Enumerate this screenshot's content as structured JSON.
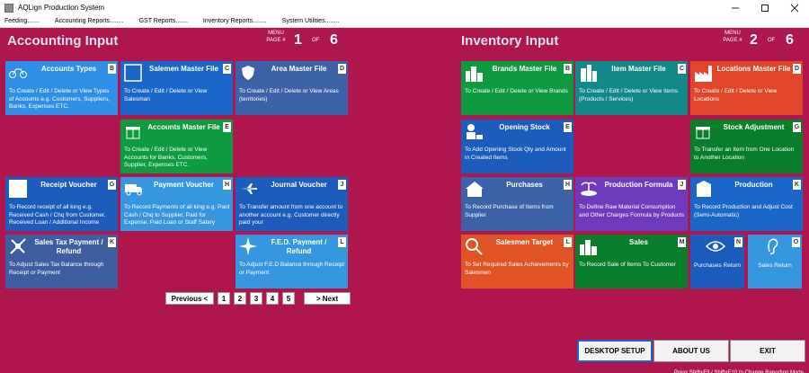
{
  "window": {
    "title": "AQLign Production System"
  },
  "menu": [
    "Feeding.......",
    "Accounting Reports........",
    "GST Reports.......",
    "Inventory Reports........",
    "System Utilities........"
  ],
  "accounting": {
    "title": "Accounting Input",
    "menu_label": "MENU",
    "page_label": "PAGE #",
    "page": "1",
    "of": "OF",
    "total": "6",
    "tiles": [
      {
        "title": "Accounts Types",
        "key": "B",
        "desc": "To Create / Edit / Delete or View Types of Accounts e.g. Customers, Suppliers, Banks, Expenses ETC.",
        "icon": "bicycle-icon"
      },
      {
        "title": "Salemen Master File",
        "key": "C",
        "desc": "To Create / Edit / Delete or View Salesman",
        "icon": "blank-square-icon"
      },
      {
        "title": "Area Master File",
        "key": "D",
        "desc": "To Create / Edit / Delete or View Areas (territories)",
        "icon": "shield-icon"
      },
      {
        "title": "Accounts Master File",
        "key": "E",
        "desc": "To Create / Edit / Delete or View Accounts for Banks, Customers, Supplier, Expenses ETC.",
        "icon": "gift-icon"
      },
      {
        "title": "Receipt Voucher",
        "key": "G",
        "desc": "To Record receipt of all king e.g. Received Cash / Chq from Customer, Received Loan / Additional Income",
        "icon": "blank-square-icon"
      },
      {
        "title": "Payment Voucher",
        "key": "H",
        "desc": "To Record Payments of all king e.g. Paid Cash / Chq to Supplier, Paid for Expense, Paid Loan or Staff Salary",
        "icon": "ambulance-icon"
      },
      {
        "title": "Journal Voucher",
        "key": "J",
        "desc": "To Transfer amount from one account to another account e.g. Customer directly paid your",
        "icon": "airplane-icon"
      },
      {
        "title": "Sales Tax Payment / Refund",
        "key": "K",
        "desc": "To Adjust Sales Tax Balance through Receipt or Payment",
        "icon": "plane-crossed-icon"
      },
      {
        "title": "F.E.D. Payment / Refund",
        "key": "L",
        "desc": "To Adjust F.E.D Balance through Receipt or Payment",
        "icon": "sparkle-icon"
      }
    ]
  },
  "inventory": {
    "title": "Inventory Input",
    "menu_label": "MENU",
    "page_label": "PAGE #",
    "page": "2",
    "of": "OF",
    "total": "6",
    "tiles": [
      {
        "title": "Brands Master File",
        "key": "B",
        "desc": "To Create / Edit / Delete or View Brands",
        "icon": "city-icon"
      },
      {
        "title": "Item Master File",
        "key": "C",
        "desc": "To Create / Edit / Delete or View Items (Products / Services)",
        "icon": "buildings-icon"
      },
      {
        "title": "Locations Master File",
        "key": "D",
        "desc": "To Create / Edit / Delete or View Locations",
        "icon": "factory-icon"
      },
      {
        "title": "Opening Stock",
        "key": "E",
        "desc": "To Add Opening Stock Qty and Amount in Created Items",
        "icon": "chef-icon"
      },
      {
        "title": "Stock Adjustment",
        "key": "G",
        "desc": "To Transfer an Item from One Location to Another Location",
        "icon": "gift-icon"
      },
      {
        "title": "Purchases",
        "key": "H",
        "desc": "To Record Purchase of Items from Supplier",
        "icon": "house-icon"
      },
      {
        "title": "Production Formula",
        "key": "J",
        "desc": "To Define Raw Material Consumption and Other Charges Formula by Products",
        "icon": "island-icon"
      },
      {
        "title": "Production",
        "key": "K",
        "desc": "To Record Production and Adjust Cost (Semi-Automatic)",
        "icon": "building-icon"
      },
      {
        "title": "Salesmen Target",
        "key": "L",
        "desc": "To Set Required Sales Achievements by Salesmen",
        "icon": "lollipop-icon"
      },
      {
        "title": "Sales",
        "key": "M",
        "desc": "To Record Sale of Items To Customer",
        "icon": "city-icon"
      },
      {
        "title": "Purchases Return",
        "key": "N",
        "icon": "eye-icon"
      },
      {
        "title": "Sales Return",
        "key": "O",
        "icon": "ear-icon"
      }
    ]
  },
  "pager": {
    "prev": "Previous <",
    "pages": [
      "1",
      "2",
      "3",
      "4",
      "5"
    ],
    "next": "> Next"
  },
  "bottom": {
    "desktop_setup": "DESKTOP SETUP",
    "about": "ABOUT US",
    "exit": "EXIT"
  },
  "footer_hint": "Press Shift+F9 / Shift+F10 to Change Reporting Mode"
}
